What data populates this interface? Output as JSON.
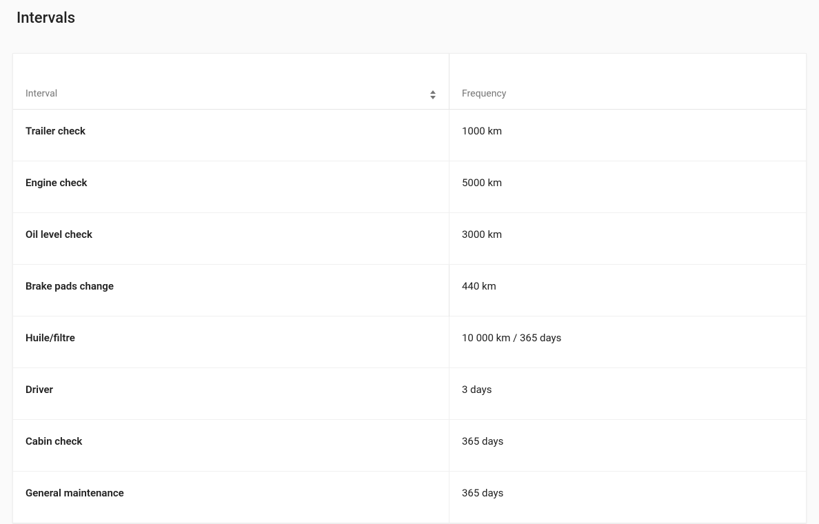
{
  "page": {
    "title": "Intervals"
  },
  "table": {
    "columns": {
      "interval": "Interval",
      "frequency": "Frequency"
    },
    "rows": [
      {
        "interval": "Trailer check",
        "frequency": "1000 km"
      },
      {
        "interval": "Engine check",
        "frequency": "5000 km"
      },
      {
        "interval": "Oil level check",
        "frequency": "3000 km"
      },
      {
        "interval": "Brake pads change",
        "frequency": "440 km"
      },
      {
        "interval": "Huile/filtre",
        "frequency": "10 000 km / 365 days"
      },
      {
        "interval": "Driver",
        "frequency": "3 days"
      },
      {
        "interval": "Cabin check",
        "frequency": "365 days"
      },
      {
        "interval": "General maintenance",
        "frequency": "365 days"
      }
    ]
  }
}
